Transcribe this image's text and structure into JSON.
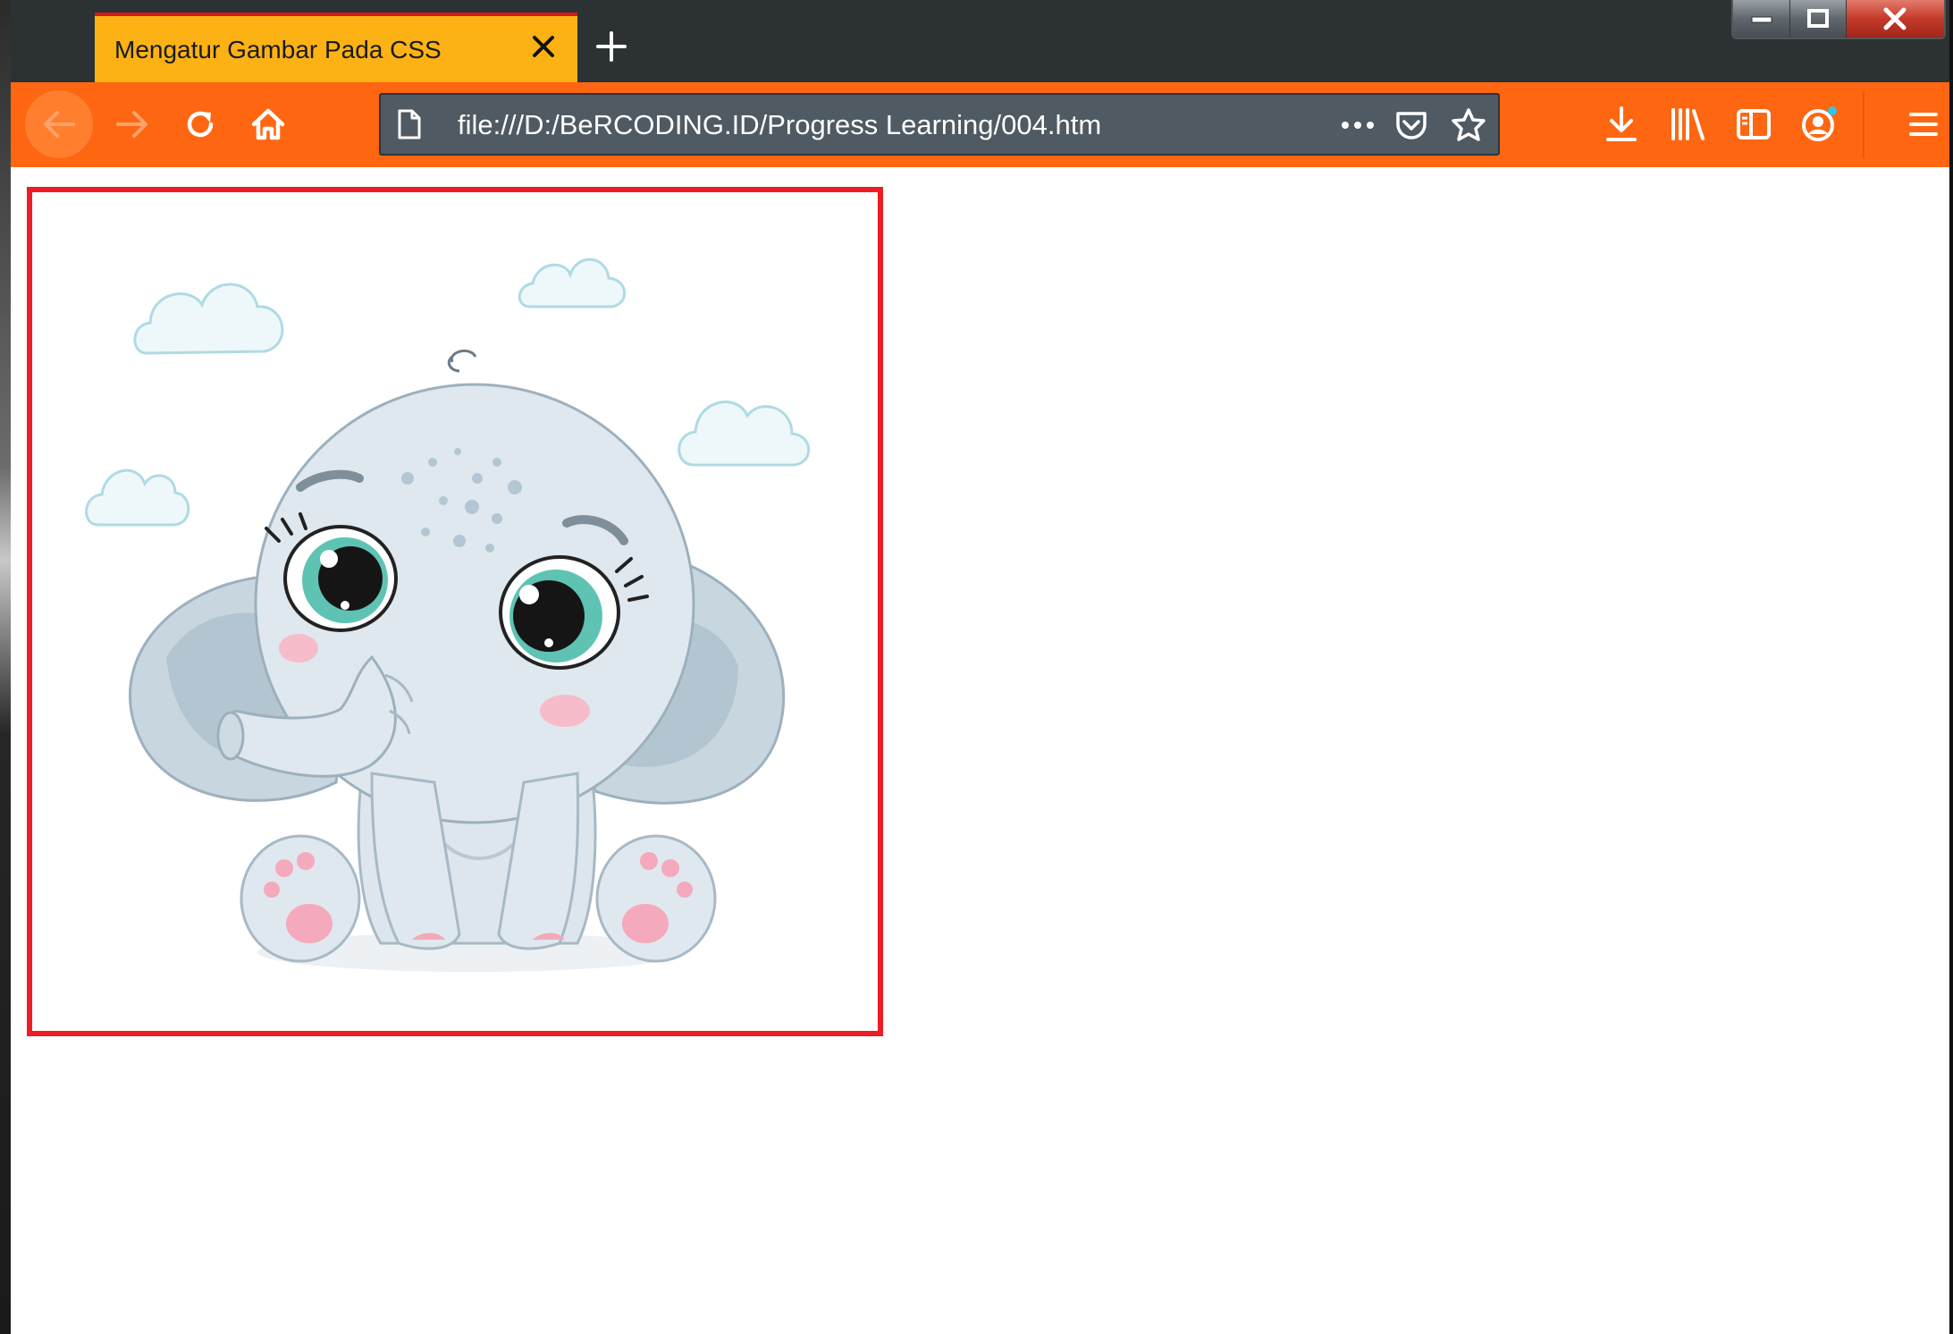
{
  "browser": {
    "tab": {
      "title": "Mengatur Gambar Pada CSS"
    },
    "address_bar": {
      "value": "file:///D:/BeRCODING.ID/Progress Learning/004.htm"
    },
    "icons": {
      "back": "arrow-left-icon",
      "forward": "arrow-right-icon",
      "reload": "reload-icon",
      "home": "home-icon",
      "page": "page-icon",
      "more": "ellipsis-icon",
      "pocket": "pocket-icon",
      "bookmark": "star-icon",
      "downloads": "download-icon",
      "library": "library-icon",
      "sidebar": "sidebar-icon",
      "account": "account-icon",
      "menu": "hamburger-icon"
    },
    "colors": {
      "toolbar": "#ff6611",
      "tab": "#fcb215",
      "tab_accent": "#d4181c",
      "tabstrip": "#2c3134",
      "urlbar": "#4f5a62"
    }
  },
  "page": {
    "image": {
      "subject": "baby elephant illustration",
      "border_color": "#ee1c25"
    }
  }
}
